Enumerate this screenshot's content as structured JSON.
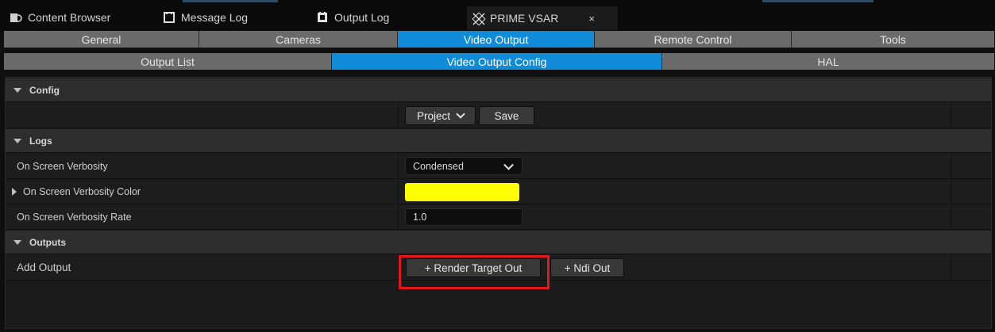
{
  "tabs": [
    {
      "label": "Content Browser",
      "icon": "content-browser-icon"
    },
    {
      "label": "Message Log",
      "icon": "message-log-icon"
    },
    {
      "label": "Output Log",
      "icon": "output-log-icon"
    },
    {
      "label": "PRIME VSAR",
      "icon": "prime-vsar-icon",
      "close": "×"
    }
  ],
  "main_tabs": [
    "General",
    "Cameras",
    "Video Output",
    "Remote Control",
    "Tools"
  ],
  "sub_tabs": [
    "Output List",
    "Video Output Config",
    "HAL"
  ],
  "sections": {
    "config": {
      "title": "Config",
      "project_label": "Project",
      "save_label": "Save"
    },
    "logs": {
      "title": "Logs",
      "verbosity_label": "On Screen Verbosity",
      "verbosity_value": "Condensed",
      "color_label": "On Screen Verbosity Color",
      "color_value": "#ffff00",
      "rate_label": "On Screen Verbosity Rate",
      "rate_value": "1.0"
    },
    "outputs": {
      "title": "Outputs",
      "add_label": "Add Output",
      "render_target_button": "+ Render Target Out",
      "ndi_button": "+ Ndi Out"
    }
  },
  "colors": {
    "selected_tab": "#0f8bd8",
    "highlight": "#e2181c",
    "verbosity_color": "#ffff00"
  }
}
